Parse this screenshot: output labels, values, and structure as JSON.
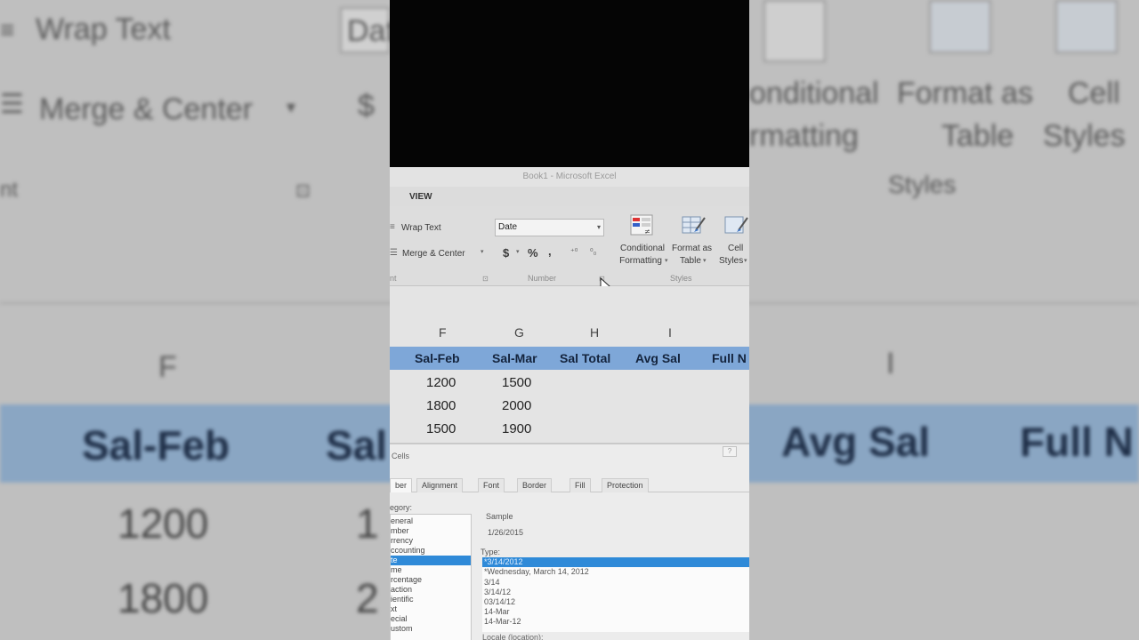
{
  "window": {
    "title": "Book1 - Microsoft Excel"
  },
  "ribbon": {
    "active_tab": "VIEW",
    "wrap_text": "Wrap Text",
    "merge_center": "Merge & Center",
    "alignment_group_label": "nt",
    "number_format_value": "Date",
    "currency_symbol": "$",
    "percent_symbol": "%",
    "comma_symbol": ",",
    "number_group_label": "Number",
    "conditional_formatting": [
      "Conditional",
      "Formatting"
    ],
    "format_as_table": [
      "Format as",
      "Table"
    ],
    "cell_styles": [
      "Cell",
      "Styles"
    ],
    "styles_group_label": "Styles"
  },
  "sheet": {
    "columns": [
      "F",
      "G",
      "H",
      "I"
    ],
    "headers": [
      "Sal-Feb",
      "Sal-Mar",
      "Sal Total",
      "Avg Sal",
      "Full N"
    ],
    "rows": [
      [
        "1200",
        "1500"
      ],
      [
        "1800",
        "2000"
      ],
      [
        "1500",
        "1900"
      ]
    ]
  },
  "dialog": {
    "title": "Cells",
    "close": "?",
    "tabs": [
      "ber",
      "Alignment",
      "Font",
      "Border",
      "Fill",
      "Protection"
    ],
    "category_label": "egory:",
    "categories": [
      "eneral",
      "mber",
      "rrency",
      "ccounting",
      "te",
      "me",
      "rcentage",
      "action",
      "ientific",
      "xt",
      "ecial",
      "ustom"
    ],
    "selected_category_index": 4,
    "sample_label": "Sample",
    "sample_value": "1/26/2015",
    "type_label": "Type:",
    "types": [
      "*3/14/2012",
      "*Wednesday, March 14, 2012",
      "3/14",
      "3/14/12",
      "03/14/12",
      "14-Mar",
      "14-Mar-12"
    ],
    "selected_type_index": 0,
    "locale_label": "Locale (location):"
  },
  "background": {
    "wrap_text": "Wrap Text",
    "merge_center": "Merge & Center",
    "nt": "nt",
    "dat": "Dat",
    "dollar": "$",
    "conditional": [
      "onditional",
      "rmatting"
    ],
    "format_as": [
      "Format as",
      "Table"
    ],
    "cell": [
      "Cell",
      "Styles"
    ],
    "styles": "Styles",
    "col_f": "F",
    "col_i": "I",
    "sal_feb": "Sal-Feb",
    "sal": "Sal",
    "avg_sal": "Avg Sal",
    "full_n": "Full N",
    "v1200": "1200",
    "v1800": "1800",
    "d1": "1",
    "d2": "2"
  },
  "colors": {
    "header_fill": "#7ea7d8",
    "selection_blue": "#2f8ad8"
  }
}
